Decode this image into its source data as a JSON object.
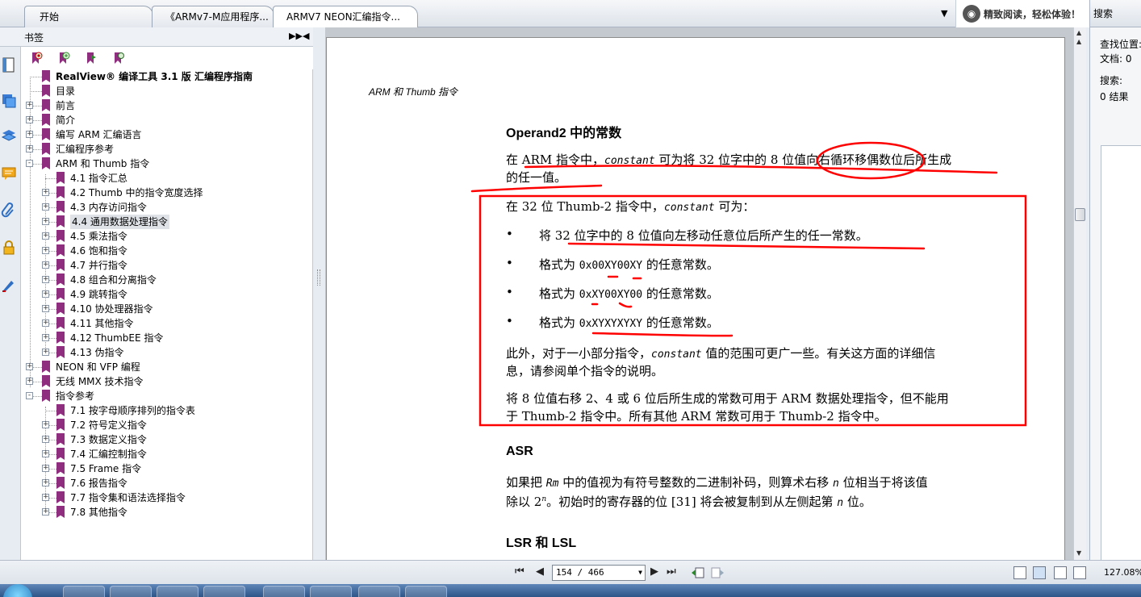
{
  "tabs": [
    {
      "label": "开始"
    },
    {
      "label": "《ARMv7-M应用程序..."
    },
    {
      "label": "ARMV7 NEON汇编指令..."
    }
  ],
  "promo": {
    "icon": "reading-mode-icon",
    "text": "精致阅读，轻松体验！"
  },
  "search_panel": {
    "title": "搜索",
    "location_label": "查找位置:",
    "document_label": "文档: 0",
    "search_label": "搜索:",
    "results": "0 结果"
  },
  "bookmarks": {
    "title": "书签",
    "toolbar_icons": [
      "add-bookmark-icon",
      "new-child-bookmark-icon",
      "goto-bookmark-icon",
      "find-bookmark-icon"
    ],
    "items": [
      {
        "label": "RealView® 编译工具 3.1 版 汇编程序指南",
        "level": 0,
        "expand": "",
        "bold": true
      },
      {
        "label": "目录",
        "level": 1,
        "expand": ""
      },
      {
        "label": "前言",
        "level": 1,
        "expand": "+"
      },
      {
        "label": "简介",
        "level": 1,
        "expand": "+"
      },
      {
        "label": "编写 ARM 汇编语言",
        "level": 1,
        "expand": "+"
      },
      {
        "label": "汇编程序参考",
        "level": 1,
        "expand": "+"
      },
      {
        "label": "ARM 和 Thumb 指令",
        "level": 1,
        "expand": "-"
      },
      {
        "label": "4.1 指令汇总",
        "level": 2,
        "expand": ""
      },
      {
        "label": "4.2 Thumb 中的指令宽度选择",
        "level": 2,
        "expand": "+"
      },
      {
        "label": "4.3 内存访问指令",
        "level": 2,
        "expand": "+"
      },
      {
        "label": "4.4 通用数据处理指令",
        "level": 2,
        "expand": "+",
        "selected": true
      },
      {
        "label": "4.5 乘法指令",
        "level": 2,
        "expand": "+"
      },
      {
        "label": "4.6 饱和指令",
        "level": 2,
        "expand": "+"
      },
      {
        "label": "4.7 并行指令",
        "level": 2,
        "expand": "+"
      },
      {
        "label": "4.8 组合和分离指令",
        "level": 2,
        "expand": "+"
      },
      {
        "label": "4.9 跳转指令",
        "level": 2,
        "expand": "+"
      },
      {
        "label": "4.10 协处理器指令",
        "level": 2,
        "expand": "+"
      },
      {
        "label": "4.11 其他指令",
        "level": 2,
        "expand": "+"
      },
      {
        "label": "4.12 ThumbEE 指令",
        "level": 2,
        "expand": "+"
      },
      {
        "label": "4.13 伪指令",
        "level": 2,
        "expand": "+"
      },
      {
        "label": "NEON 和 VFP 编程",
        "level": 1,
        "expand": "+"
      },
      {
        "label": "无线 MMX 技术指令",
        "level": 1,
        "expand": "+"
      },
      {
        "label": "指令参考",
        "level": 1,
        "expand": "-"
      },
      {
        "label": "7.1 按字母顺序排列的指令表",
        "level": 2,
        "expand": ""
      },
      {
        "label": "7.2 符号定义指令",
        "level": 2,
        "expand": "+"
      },
      {
        "label": "7.3 数据定义指令",
        "level": 2,
        "expand": "+"
      },
      {
        "label": "7.4 汇编控制指令",
        "level": 2,
        "expand": "+"
      },
      {
        "label": "7.5 Frame 指令",
        "level": 2,
        "expand": "+"
      },
      {
        "label": "7.6 报告指令",
        "level": 2,
        "expand": "+"
      },
      {
        "label": "7.7 指令集和语法选择指令",
        "level": 2,
        "expand": "+"
      },
      {
        "label": "7.8 其他指令",
        "level": 2,
        "expand": "+"
      }
    ]
  },
  "rail_icons": [
    "pages-icon",
    "layers-icon",
    "stack-icon",
    "comments-icon",
    "attachment-icon",
    "lock-icon",
    "signature-icon"
  ],
  "document": {
    "running_header": "ARM 和 Thumb 指令",
    "h_operand2": "Operand2 中的常数",
    "p1_a": "在 ARM 指令中，",
    "p1_code": "constant",
    "p1_b": " 可为将 32 位字中的 8 位值向右循环移偶数位后所生成",
    "p1_c": "的任一值。",
    "p2_a": "在 32 位 Thumb-2 指令中，",
    "p2_code": "constant",
    "p2_b": " 可为：",
    "bullet_symbol": "•",
    "b1": "将 32 位字中的 8 位值向左移动任意位后所产生的任一常数。",
    "b2_a": "格式为 ",
    "b2_code": "0x00XY00XY",
    "b2_b": " 的任意常数。",
    "b3_a": "格式为 ",
    "b3_code": "0xXY00XY00",
    "b3_b": " 的任意常数。",
    "b4_a": "格式为 ",
    "b4_code": "0xXYXYXYXY",
    "b4_b": " 的任意常数。",
    "p3_a": "此外，对于一小部分指令，",
    "p3_code": "constant",
    "p3_b": " 值的范围可更广一些。有关这方面的详细信",
    "p3_c": "息，请参阅单个指令的说明。",
    "p4_a": "将 8 位值右移 2、4 或 6 位后所生成的常数可用于 ARM 数据处理指令，但不能用",
    "p4_b": "于 Thumb-2 指令中。所有其他 ARM 常数可用于 Thumb-2 指令中。",
    "h_asr": "ASR",
    "p5_a": "如果把 ",
    "p5_code": "Rm",
    "p5_b": " 中的值视为有符号整数的二进制补码，则算术右移 ",
    "p5_n": "n",
    "p5_c": " 位相当于将该值",
    "p5_d": "除以 2",
    "p5_sup": "n",
    "p5_e": "。初始时的寄存器的位 [31] 将会被复制到从左侧起第 ",
    "p5_n2": "n",
    "p5_f": " 位。",
    "h_lsr": "LSR 和 LSL"
  },
  "annotation_color": "#ff0000",
  "navigation": {
    "page_display": "154 / 466",
    "zoom": "127.08%"
  }
}
